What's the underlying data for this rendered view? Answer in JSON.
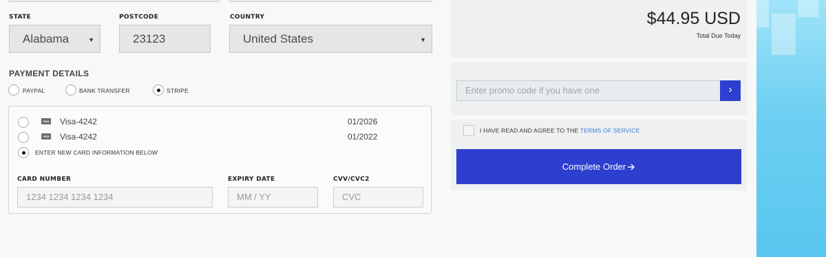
{
  "address": {
    "state_label": "STATE",
    "state_value": "Alabama",
    "postcode_label": "POSTCODE",
    "postcode_value": "23123",
    "country_label": "COUNTRY",
    "country_value": "United States"
  },
  "payment": {
    "title": "PAYMENT DETAILS",
    "methods": [
      {
        "label": "PAYPAL",
        "selected": false
      },
      {
        "label": "BANK TRANSFER",
        "selected": false
      },
      {
        "label": "STRIPE",
        "selected": true
      }
    ],
    "saved_cards": [
      {
        "brand": "VISA",
        "name": "Visa-4242",
        "expiry": "01/2026"
      },
      {
        "brand": "VISA",
        "name": "Visa-4242",
        "expiry": "01/2022"
      }
    ],
    "new_card_label": "ENTER NEW CARD INFORMATION BELOW",
    "card_number_label": "CARD NUMBER",
    "card_number_placeholder": "1234 1234 1234 1234",
    "expiry_label": "EXPIRY DATE",
    "expiry_placeholder": "MM / YY",
    "cvv_label": "CVV/CVC2",
    "cvv_placeholder": "CVC"
  },
  "summary": {
    "total": "$44.95 USD",
    "total_sub": "Total Due Today",
    "promo_placeholder": "Enter promo code if you have one",
    "promo_button_icon": "chevron-right-icon",
    "terms_prefix": "I HAVE READ AND AGREE TO THE",
    "terms_link": "TERMS OF SERVICE",
    "order_button": "Complete Order",
    "order_button_icon": "arrow-right-icon"
  },
  "colors": {
    "accent": "#2d3fcf",
    "link": "#3b7bc6"
  }
}
